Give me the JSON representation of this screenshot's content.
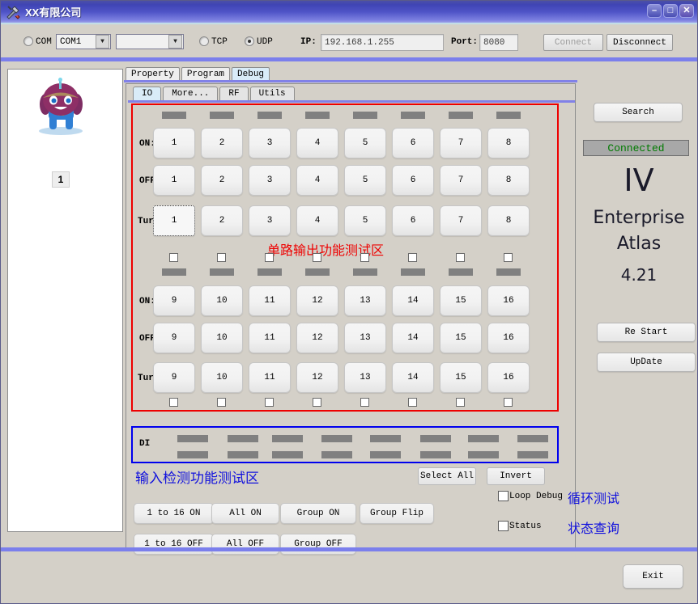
{
  "window": {
    "title": "XX有限公司",
    "icon": "tools-icon",
    "minimize_label": "–",
    "maximize_label": "□",
    "close_label": "✕"
  },
  "toolbar": {
    "com_radio_label": "COM",
    "com_radio_selected": false,
    "com_port_value": "COM1",
    "baud_value": "",
    "tcp_radio_label": "TCP",
    "tcp_radio_selected": false,
    "udp_radio_label": "UDP",
    "udp_radio_selected": true,
    "ip_label": "IP:",
    "ip_value": "192.168.1.255",
    "port_label": "Port:",
    "port_value": "8080",
    "connect_label": "Connect",
    "disconnect_label": "Disconnect"
  },
  "sidebar": {
    "device_label": "1"
  },
  "tabs_outer": [
    {
      "label": "Property",
      "active": false
    },
    {
      "label": "Program",
      "active": false
    },
    {
      "label": "Debug",
      "active": true
    }
  ],
  "tabs_inner": [
    {
      "label": "IO",
      "active": true
    },
    {
      "label": "More...",
      "active": false
    },
    {
      "label": "RF",
      "active": false
    },
    {
      "label": "Utils",
      "active": false
    }
  ],
  "io": {
    "row_labels": {
      "on": "ON:",
      "off": "OFF",
      "turn": "Turn"
    },
    "group1": [
      "1",
      "2",
      "3",
      "4",
      "5",
      "6",
      "7",
      "8"
    ],
    "group2": [
      "9",
      "10",
      "11",
      "12",
      "13",
      "14",
      "15",
      "16"
    ],
    "focused_button": "Turn 1",
    "di_label": "DI",
    "annotation_output": "单路输出功能测试区",
    "annotation_input": "输入检测功能测试区",
    "annotation_output_color": "#ee0000",
    "annotation_input_color": "#1111dd",
    "output_box_color": "#ee0000",
    "input_box_color": "#0000ee"
  },
  "actions": {
    "select_all": "Select All",
    "invert": "Invert",
    "one_to_16_on": "1 to 16 ON",
    "all_on": "All ON",
    "group_on": "Group ON",
    "group_flip": "Group Flip",
    "one_to_16_off": "1 to 16 OFF",
    "all_off": "All OFF",
    "group_off": "Group OFF",
    "loop_debug": "Loop Debug",
    "loop_debug_checked": false,
    "status_cb": "Status",
    "status_checked": false,
    "annotation_loop": "循环测试",
    "annotation_status": "状态查询"
  },
  "right": {
    "search_label": "Search",
    "status_text": "Connected",
    "status_color": "#007a00",
    "model": "IV",
    "brand": "Enterprise",
    "product": "Atlas",
    "version": "4.21",
    "restart_label": "Re Start",
    "update_label": "UpDate"
  },
  "footer": {
    "exit_label": "Exit"
  }
}
